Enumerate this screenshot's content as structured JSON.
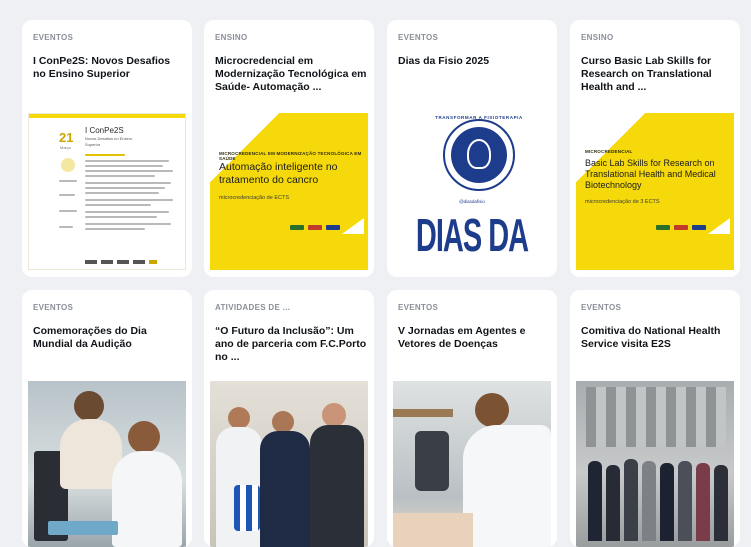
{
  "cards": [
    {
      "category": "EVENTOS",
      "title": "I ConPe2S: Novos Desafios no Ensino Superior"
    },
    {
      "category": "ENSINO",
      "title": "Microcredencial em Modernização Tecnológica em Saúde- Automação ..."
    },
    {
      "category": "EVENTOS",
      "title": "Dias da Fisio 2025"
    },
    {
      "category": "ENSINO",
      "title": "Curso Basic Lab Skills for Research on Translational Health and ..."
    },
    {
      "category": "EVENTOS",
      "title": "Comemorações do Dia Mundial da Audição"
    },
    {
      "category": "ATIVIDADES DE ...",
      "title": "“O Futuro da Inclusão”: Um ano de parceria com F.C.Porto no ..."
    },
    {
      "category": "EVENTOS",
      "title": "V Jornadas em Agentes e Vetores de Doenças"
    },
    {
      "category": "EVENTOS",
      "title": "Comitiva do National Health Service visita E2S"
    }
  ],
  "poster": {
    "title": "I ConPe2S",
    "subtitle_1": "Novos Desafios no Ensino",
    "subtitle_2": "Superior",
    "day": "21",
    "month": "Março"
  },
  "banner_automacao": {
    "tag": "MICROCREDENCIAL EM MODERNIZAÇÃO TECNOLÓGICA EM SAÚDE",
    "heading": "Automação inteligente no tratamento do cancro",
    "detail": "microcredenciação de ECTS"
  },
  "banner_fisio": {
    "arc_text": "TRANSFORMAR A FISIOTERAPIA",
    "handle": "@diasdafisio",
    "big": "DIAS DA FISIO"
  },
  "banner_lab": {
    "tag": "MICROCREDENCIAL",
    "heading": "Basic Lab Skills for Research on Translational Health and Medical Biotechnology",
    "detail": "microcredenciação de 3 ECTS"
  },
  "colors": {
    "yellow": "#f5d90b",
    "navy": "#1e3c8c",
    "page_bg": "#eef0f3"
  }
}
